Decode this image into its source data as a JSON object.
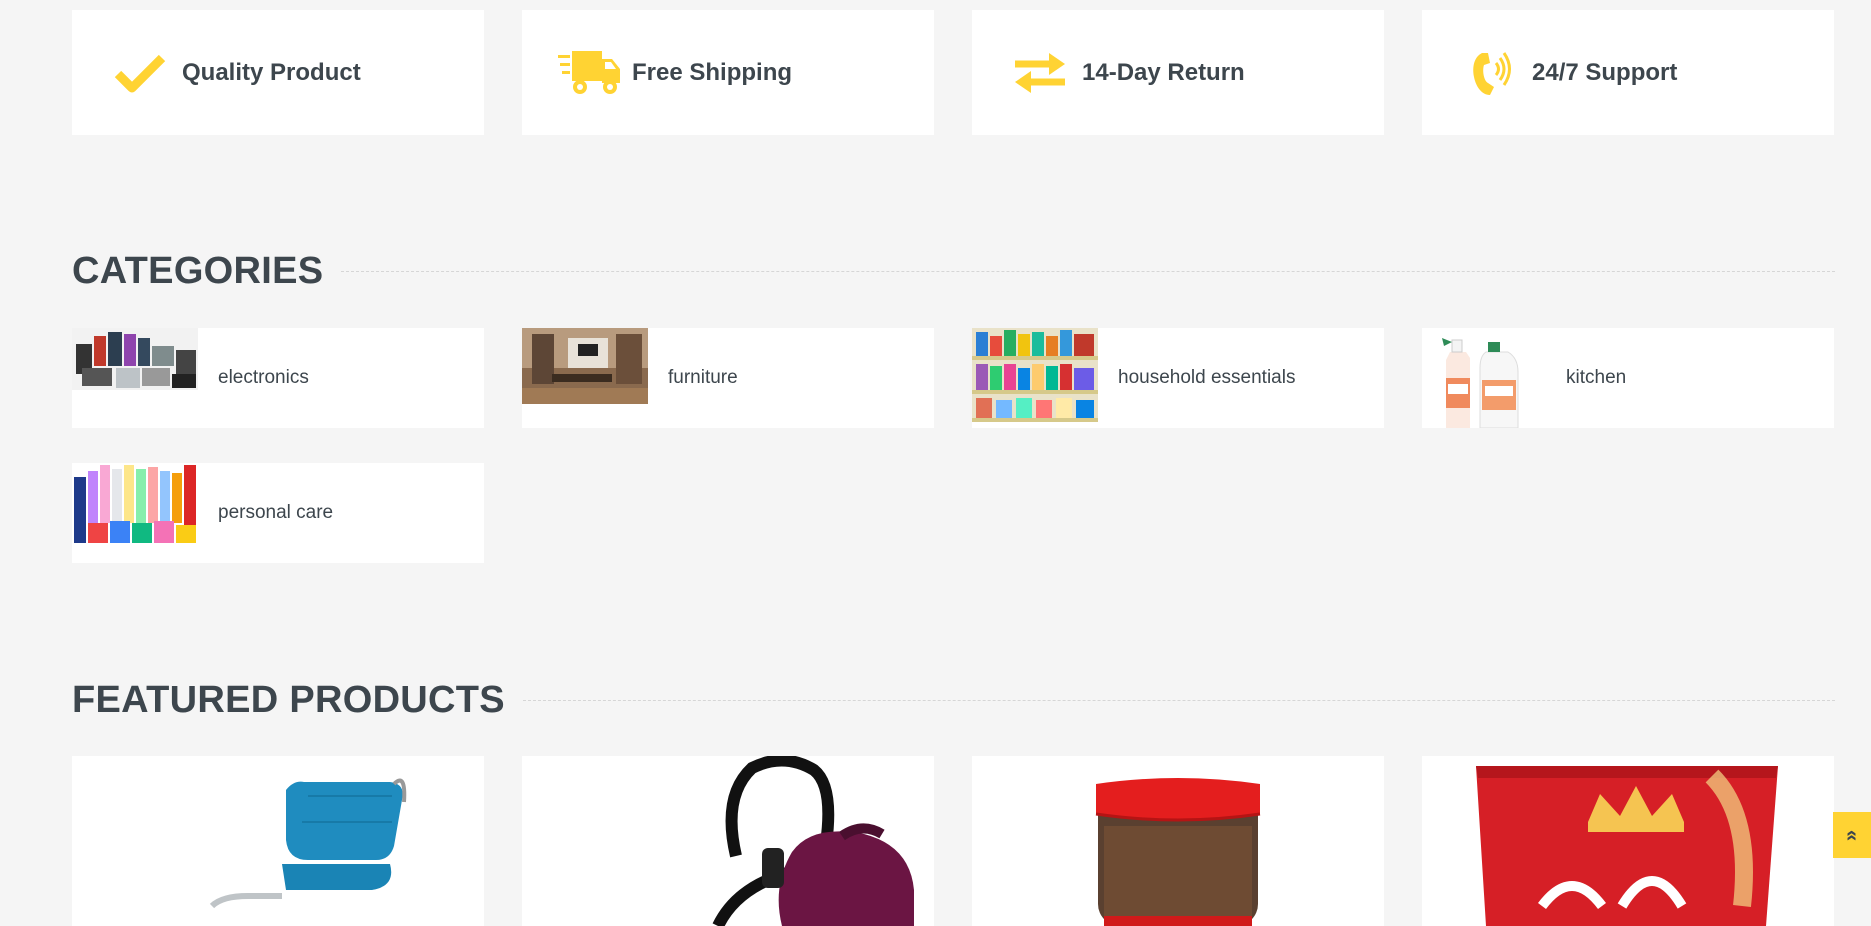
{
  "features": [
    {
      "label": "Quality Product",
      "icon": "check-icon"
    },
    {
      "label": "Free Shipping",
      "icon": "shipping-truck-icon"
    },
    {
      "label": "14-Day Return",
      "icon": "exchange-arrows-icon"
    },
    {
      "label": "24/7 Support",
      "icon": "phone-volume-icon"
    }
  ],
  "categories_section": {
    "title": "CATEGORIES",
    "items": [
      {
        "label": "electronics",
        "image": "electronics-image"
      },
      {
        "label": "furniture",
        "image": "furniture-image"
      },
      {
        "label": "household essentials",
        "image": "household-essentials-image"
      },
      {
        "label": "kitchen",
        "image": "kitchen-image"
      },
      {
        "label": "personal care",
        "image": "personal-care-image"
      }
    ]
  },
  "featured_section": {
    "title": "FEATURED PRODUCTS",
    "products": [
      {
        "image": "office-chair-image"
      },
      {
        "image": "vacuum-cleaner-image"
      },
      {
        "image": "coffee-jar-image"
      },
      {
        "image": "snack-bag-image"
      }
    ]
  },
  "back_to_top": {
    "icon": "double-chevron-up-icon",
    "glyph": "»"
  },
  "colors": {
    "accent": "#ffd333",
    "text": "#3d464d",
    "background": "#f5f5f5",
    "card": "#ffffff"
  }
}
